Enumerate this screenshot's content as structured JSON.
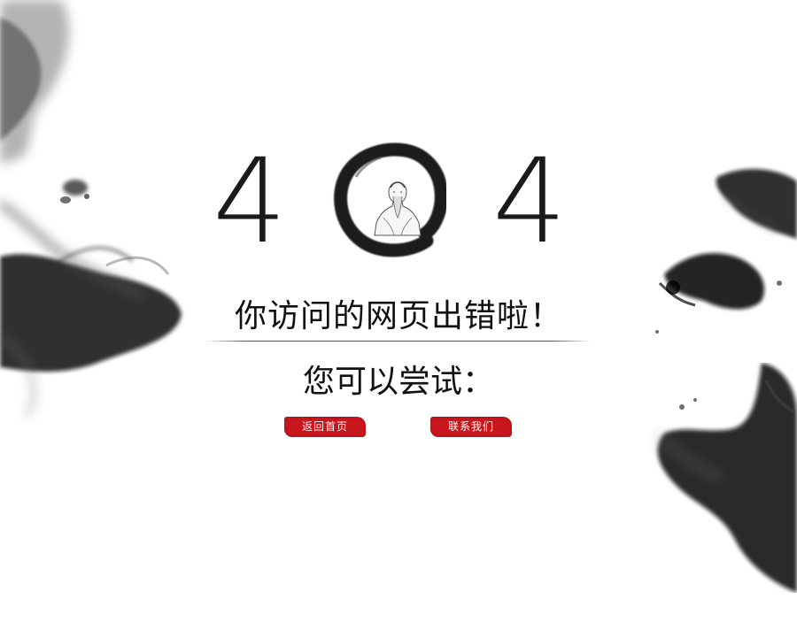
{
  "error_code": {
    "first_digit": "4",
    "last_digit": "4"
  },
  "message": {
    "headline": "你访问的网页出错啦！",
    "suggestion": "您可以尝试："
  },
  "actions": {
    "home_label": "返回首页",
    "contact_label": "联系我们"
  },
  "colors": {
    "accent": "#c8161d",
    "ink": "#111111"
  },
  "icons": [
    "ink-splash-decoration",
    "enso-ring",
    "sage-portrait"
  ]
}
